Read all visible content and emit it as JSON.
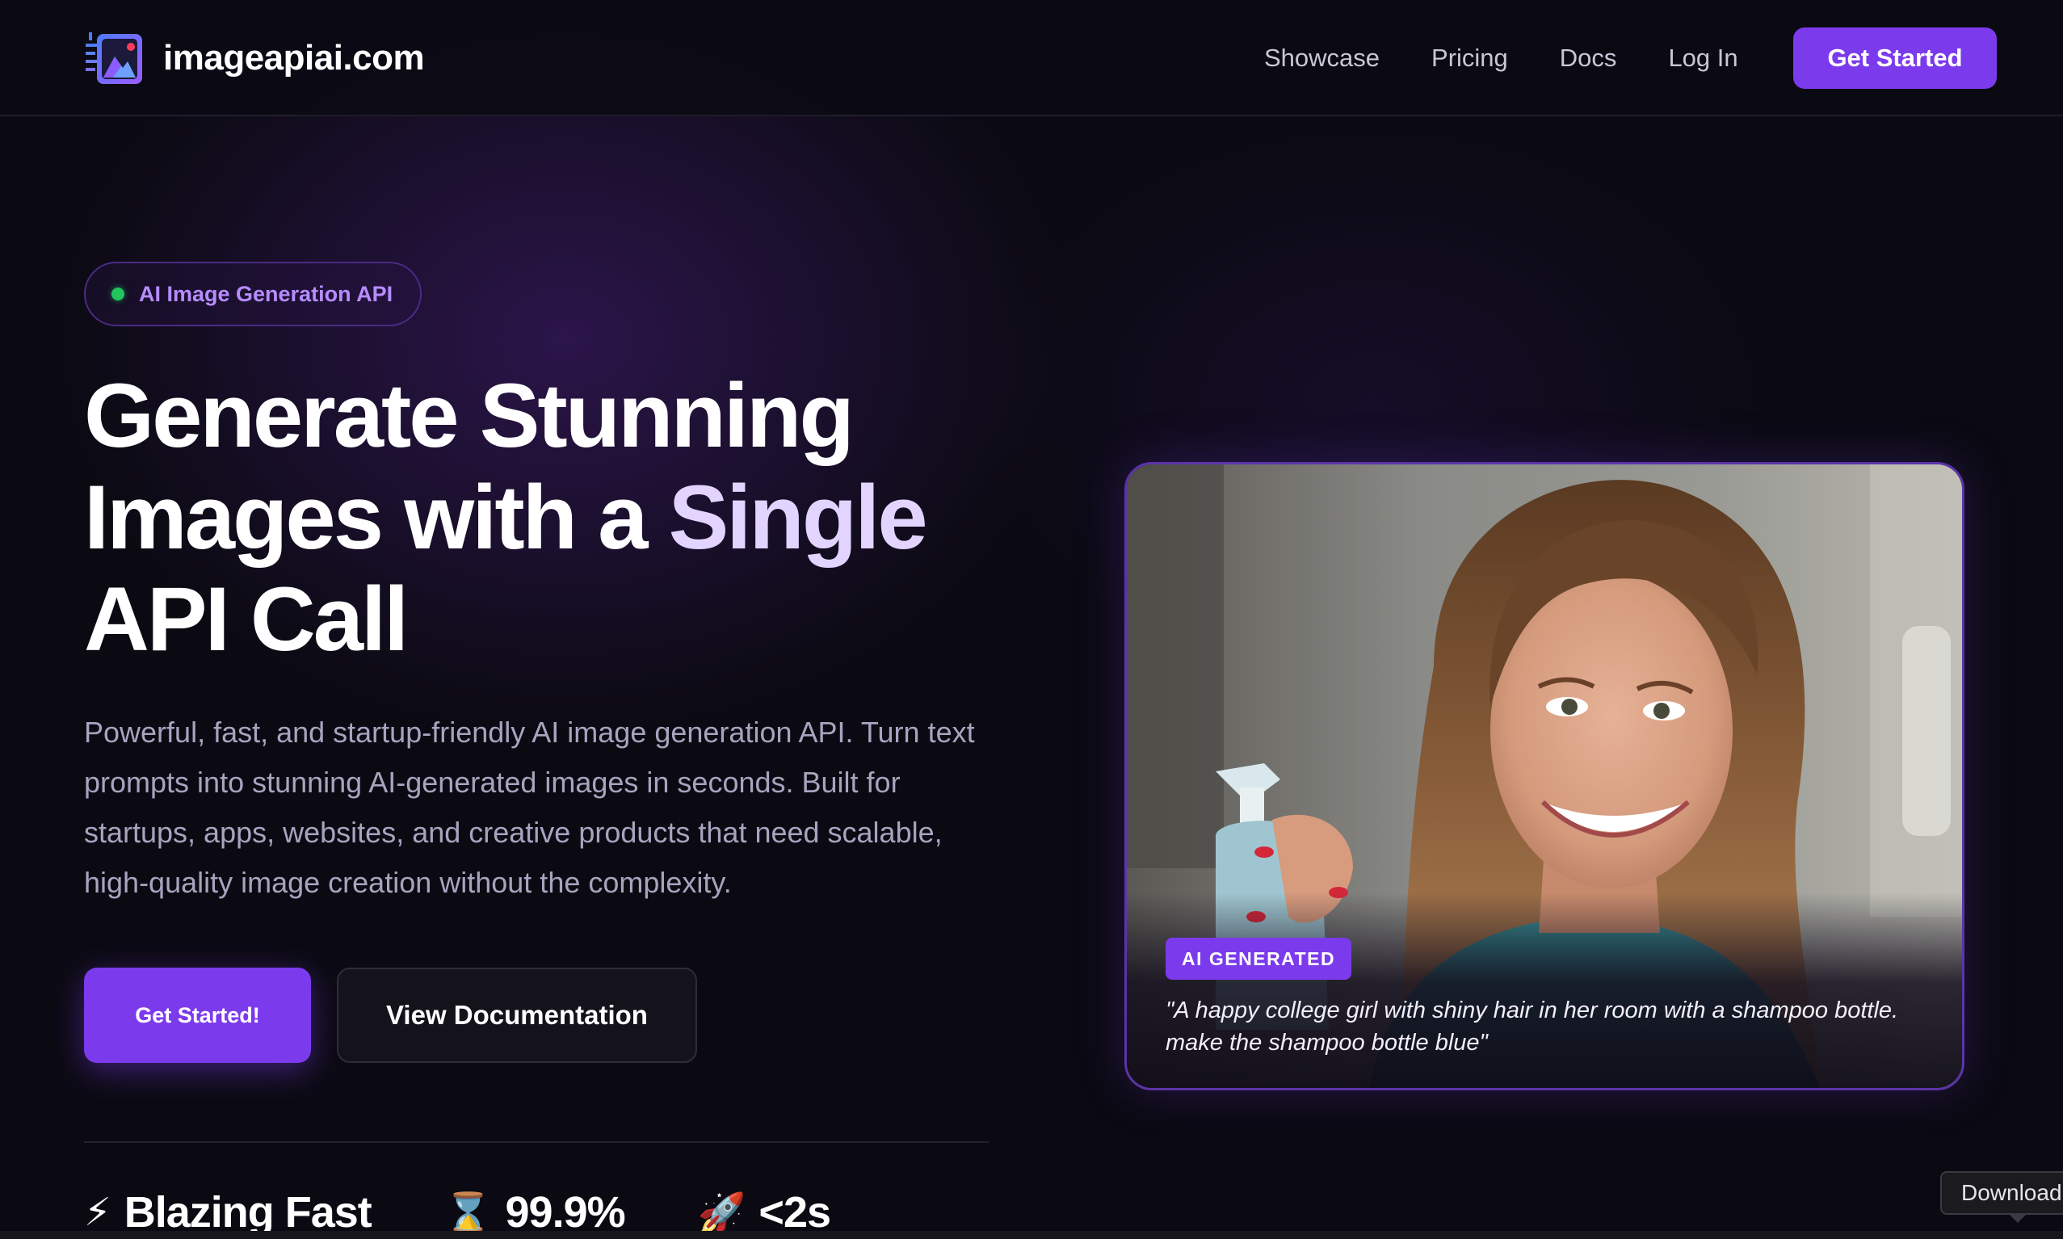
{
  "nav": {
    "brand": "imageapiai.com",
    "links": [
      "Showcase",
      "Pricing",
      "Docs",
      "Log In"
    ],
    "cta": "Get Started"
  },
  "hero": {
    "pill": "AI Image Generation API",
    "headline_part1": "Generate Stunning Images with a ",
    "headline_accent": "Single",
    "headline_part2": " API Call",
    "description": "Powerful, fast, and startup-friendly AI image generation API. Turn text prompts into stunning AI-generated images in seconds. Built for startups, apps, websites, and creative products that need scalable, high-quality image creation without the complexity.",
    "primary_button": "Get Started!",
    "secondary_button": "View Documentation",
    "stats": [
      {
        "icon": "lightning-icon",
        "emoji": "⚡",
        "label": "Blazing Fast"
      },
      {
        "icon": "hourglass-icon",
        "emoji": "⌛",
        "label": "99.9%"
      },
      {
        "icon": "rocket-icon",
        "emoji": "🚀",
        "label": "<2s"
      }
    ]
  },
  "showcase": {
    "badge": "AI GENERATED",
    "caption": "\"A happy college girl with shiny hair in her room with a shampoo bottle. make the shampoo bottle blue\""
  },
  "tooltip": {
    "download": "Download"
  },
  "colors": {
    "accent": "#7c3aed",
    "background": "#0b0a12",
    "pill_text": "#b68cff",
    "status_dot": "#22c55e"
  }
}
